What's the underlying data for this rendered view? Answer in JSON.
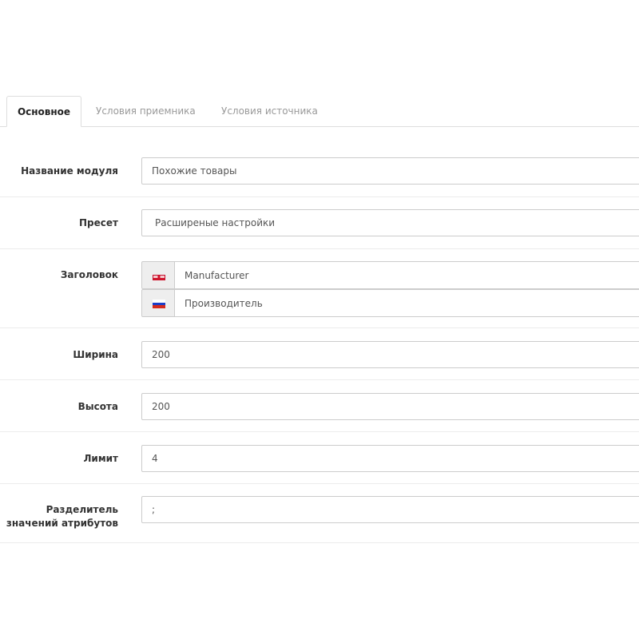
{
  "tabs": [
    {
      "label": "Основное",
      "active": true
    },
    {
      "label": "Условия приемника",
      "active": false
    },
    {
      "label": "Условия источника",
      "active": false
    }
  ],
  "form": {
    "module_name": {
      "label": "Название модуля",
      "value": "Похожие товары"
    },
    "preset": {
      "label": "Пресет",
      "value": "Расширеные настройки"
    },
    "heading": {
      "label": "Заголовок",
      "en": {
        "flag": "uk-flag-icon",
        "value": "Manufacturer"
      },
      "ru": {
        "flag": "russia-flag-icon",
        "value": "Производитель"
      }
    },
    "width": {
      "label": "Ширина",
      "value": "200"
    },
    "height": {
      "label": "Высота",
      "value": "200"
    },
    "limit": {
      "label": "Лимит",
      "value": "4"
    },
    "separator": {
      "label_line1": "Разделитель",
      "label_line2": "значений атрибутов",
      "value": ";"
    }
  },
  "colors": {
    "border": "#cccccc",
    "addon_bg": "#eeeeee",
    "label": "#333333",
    "muted_tab": "#999999"
  }
}
